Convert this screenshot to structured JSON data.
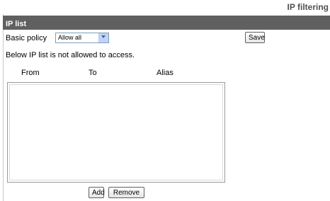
{
  "header": {
    "title": "IP filtering"
  },
  "section": {
    "title": "IP list"
  },
  "policy": {
    "label": "Basic policy",
    "selected": "Allow all"
  },
  "buttons": {
    "save": "Save",
    "add": "Add",
    "remove": "Remove"
  },
  "notice": "Below IP list is not allowed to access.",
  "table": {
    "columns": [
      "From",
      "To",
      "Alias"
    ]
  }
}
